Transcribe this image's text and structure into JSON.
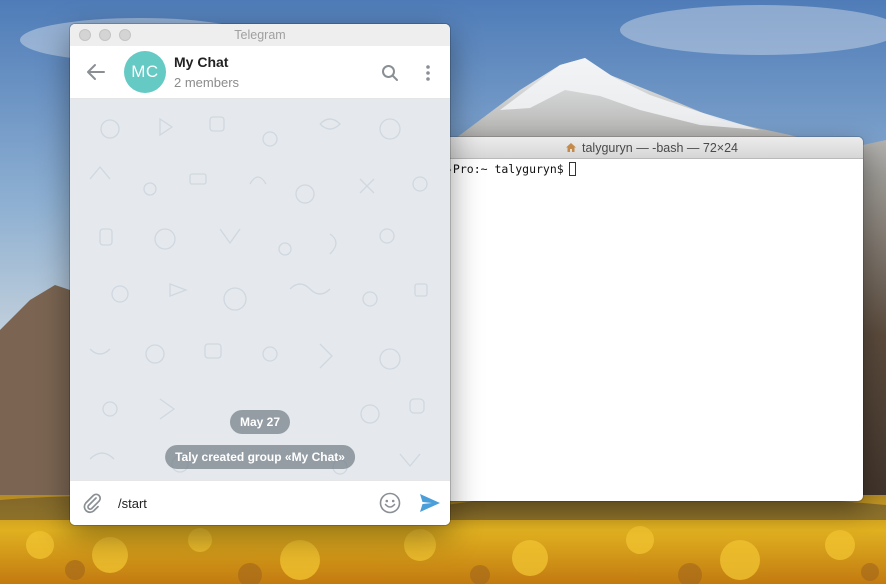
{
  "telegram": {
    "window_title": "Telegram",
    "chat": {
      "avatar_initials": "MC",
      "avatar_color": "#65c9c4",
      "title": "My Chat",
      "subtitle": "2 members"
    },
    "icons": {
      "back": "arrow-left-icon",
      "search": "search-icon",
      "menu": "more-vertical-icon",
      "attach": "paperclip-icon",
      "emoji": "smiley-icon",
      "send": "send-icon"
    },
    "messages": {
      "date_label": "May 27",
      "service_text": "Taly created group «My Chat»"
    },
    "composer": {
      "value": "/start"
    },
    "accent_color": "#4a9ed9"
  },
  "terminal": {
    "window_title": "talyguryn — -bash — 72×24",
    "prompt_line": "-Pro:~ talyguryn$"
  }
}
